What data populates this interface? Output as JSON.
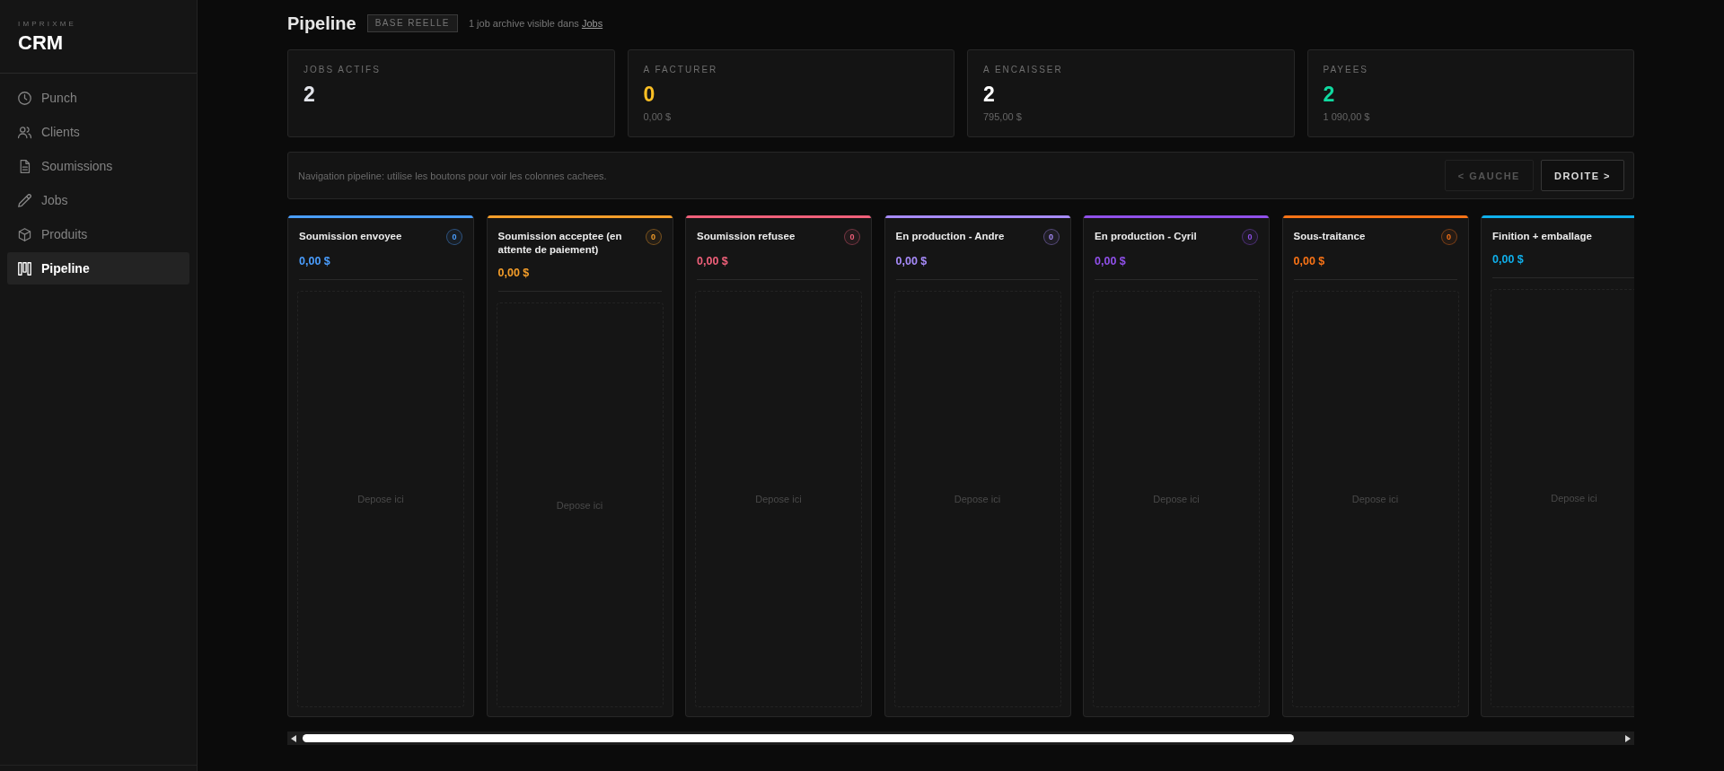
{
  "sidebar": {
    "brand": "IMPRIXME",
    "title": "CRM",
    "items": [
      {
        "label": "Punch",
        "selected": false
      },
      {
        "label": "Clients",
        "selected": false
      },
      {
        "label": "Soumissions",
        "selected": false
      },
      {
        "label": "Jobs",
        "selected": false
      },
      {
        "label": "Produits",
        "selected": false
      },
      {
        "label": "Pipeline",
        "selected": true
      }
    ]
  },
  "header": {
    "title": "Pipeline",
    "tag": "BASE REELLE",
    "note": "1 job archive visible dans",
    "note_link": "Jobs"
  },
  "stats": [
    {
      "label": "JOBS ACTIFS",
      "value": "2",
      "color": "#e2e4ea"
    },
    {
      "label": "A FACTURER",
      "value": "0",
      "sub": "0,00 $",
      "color": "#fbbf24"
    },
    {
      "label": "A ENCAISSER",
      "value": "2",
      "sub": "795,00 $",
      "color": "#ffffff"
    },
    {
      "label": "PAYEES",
      "value": "2",
      "sub": "1 090,00 $",
      "color": "#10d9a0"
    }
  ],
  "nav": {
    "hint": "Navigation pipeline: utilise les boutons pour voir les colonnes cachees.",
    "buttons": [
      {
        "label": "< GAUCHE",
        "disabled": true
      },
      {
        "label": "DROITE >",
        "disabled": false
      }
    ]
  },
  "columns": [
    {
      "title": "Soumission envoyee",
      "count": "0",
      "amount": "0,00 $",
      "color": "#4a9eff",
      "drop_text": "Depose ici"
    },
    {
      "title": "Soumission acceptee (en attente de paiement)",
      "count": "0",
      "amount": "0,00 $",
      "color": "#f59e2a",
      "drop_text": "Depose ici"
    },
    {
      "title": "Soumission refusee",
      "count": "0",
      "amount": "0,00 $",
      "color": "#f0607a",
      "drop_text": "Depose ici"
    },
    {
      "title": "En production - Andre",
      "count": "0",
      "amount": "0,00 $",
      "color": "#a78bfa",
      "drop_text": "Depose ici"
    },
    {
      "title": "En production - Cyril",
      "count": "0",
      "amount": "0,00 $",
      "color": "#9050ea",
      "drop_text": "Depose ici"
    },
    {
      "title": "Sous-traitance",
      "count": "0",
      "amount": "0,00 $",
      "color": "#f97316",
      "drop_text": "Depose ici"
    },
    {
      "title": "Finition + emballage",
      "amount": "0,00 $",
      "color": "#0fb0ec",
      "drop_text": "Depose ici"
    }
  ]
}
